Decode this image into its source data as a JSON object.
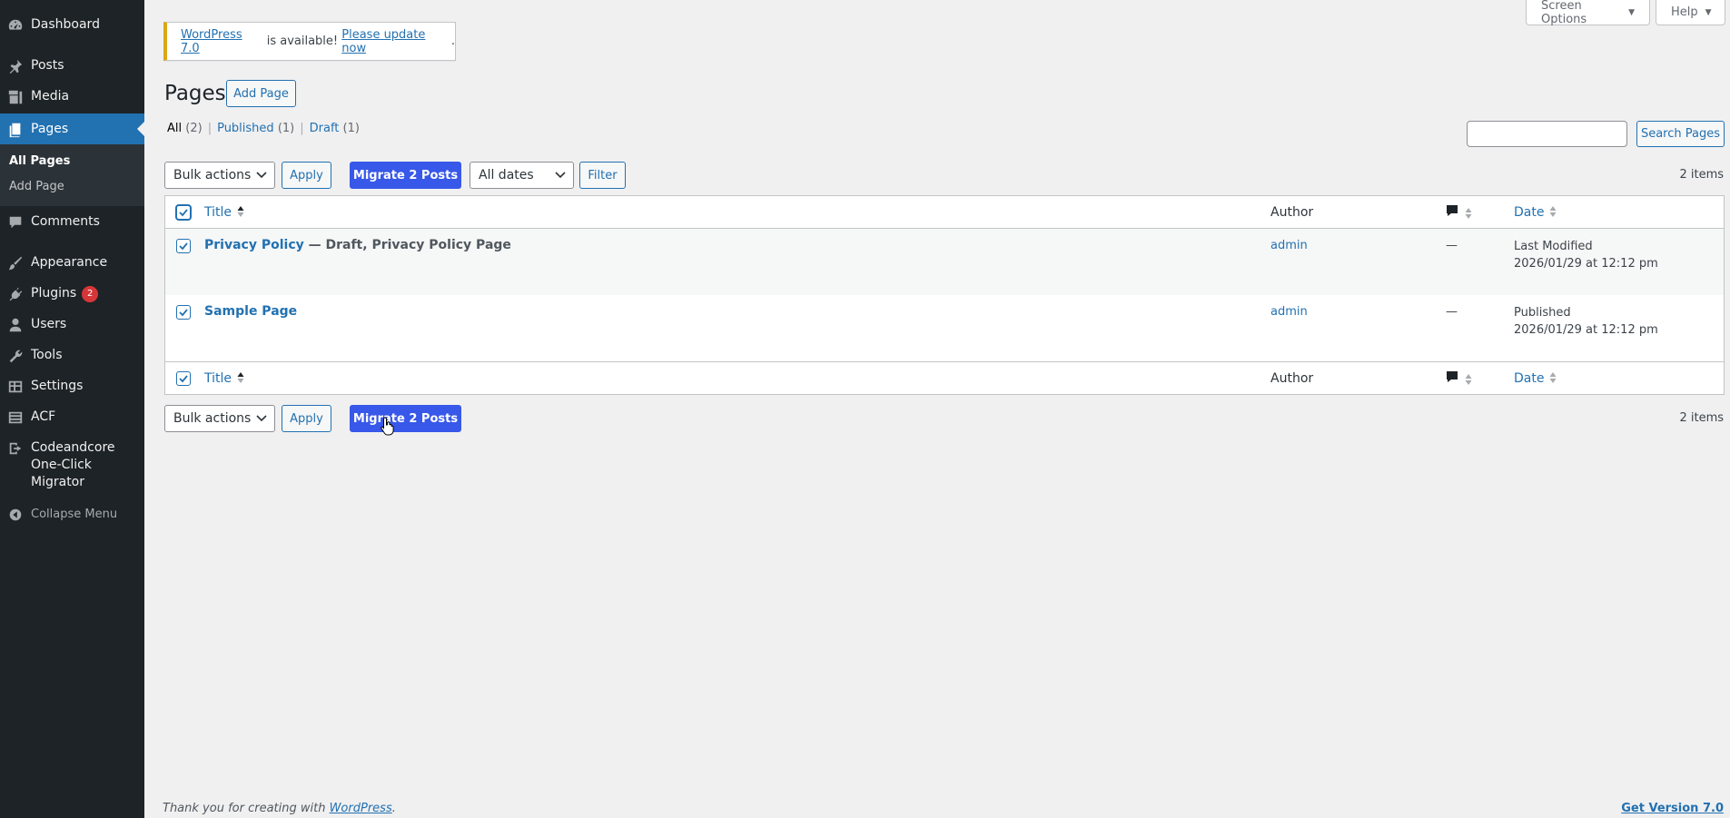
{
  "sidebar": {
    "items": [
      {
        "label": "Dashboard",
        "icon": "dashboard-icon"
      },
      {
        "label": "Posts",
        "icon": "pin-icon"
      },
      {
        "label": "Media",
        "icon": "media-icon"
      },
      {
        "label": "Pages",
        "icon": "pages-icon"
      },
      {
        "label": "Comments",
        "icon": "comment-icon"
      },
      {
        "label": "Appearance",
        "icon": "brush-icon"
      },
      {
        "label": "Plugins",
        "icon": "plugin-icon",
        "badge": "2"
      },
      {
        "label": "Users",
        "icon": "user-icon"
      },
      {
        "label": "Tools",
        "icon": "wrench-icon"
      },
      {
        "label": "Settings",
        "icon": "settings-icon"
      },
      {
        "label": "ACF",
        "icon": "table-icon"
      },
      {
        "label_lines": [
          "Codeandcore",
          "One-Click",
          "Migrator"
        ],
        "icon": "migrate-icon"
      }
    ],
    "submenu": [
      "All Pages",
      "Add Page"
    ],
    "collapse": "Collapse Menu"
  },
  "top_tabs": {
    "screen_options": "Screen Options",
    "help": "Help"
  },
  "notice": {
    "link1": "WordPress 7.0",
    "middle": " is available! ",
    "link2": "Please update now",
    "end": "."
  },
  "header": {
    "title": "Pages",
    "add_button": "Add Page"
  },
  "filters": {
    "all": "All",
    "all_count": "(2)",
    "published": "Published",
    "published_count": "(1)",
    "draft": "Draft",
    "draft_count": "(1)",
    "sep": "|"
  },
  "search": {
    "value": "",
    "button": "Search Pages"
  },
  "top_nav": {
    "bulk": "Bulk actions",
    "apply": "Apply",
    "migrate": "Migrate 2 Posts",
    "dates": "All dates",
    "filter": "Filter",
    "count": "2 items"
  },
  "bottom_nav": {
    "bulk": "Bulk actions",
    "apply": "Apply",
    "migrate": "Migrate 2 Posts",
    "count": "2 items"
  },
  "table": {
    "columns": {
      "title": "Title",
      "author": "Author",
      "date": "Date"
    },
    "rows": [
      {
        "title": "Privacy Policy",
        "state": " — Draft, Privacy Policy Page",
        "author": "admin",
        "comments": "—",
        "status": "Last Modified",
        "date": "2026/01/29 at 12:12 pm"
      },
      {
        "title": "Sample Page",
        "state": "",
        "author": "admin",
        "comments": "—",
        "status": "Published",
        "date": "2026/01/29 at 12:12 pm"
      }
    ]
  },
  "footer": {
    "text": "Thank you for creating with ",
    "link": "WordPress",
    "end": ".",
    "version": "Get Version 7.0"
  },
  "colors": {
    "sidebar": "#1d2327",
    "accent": "#2271b1",
    "migrate": "#3858e9",
    "notice": "#dba617",
    "badge": "#d63638"
  }
}
